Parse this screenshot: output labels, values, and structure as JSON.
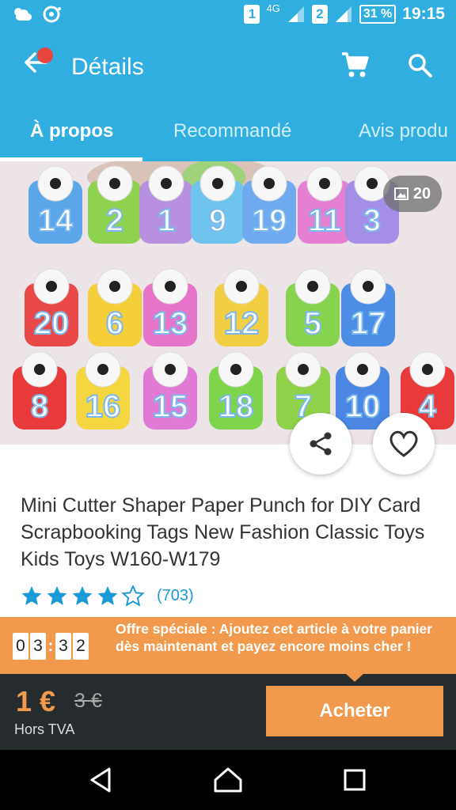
{
  "status_bar": {
    "network_4g": "4G",
    "sim1": "1",
    "sim2": "2",
    "battery": "31 %",
    "time": "19:15"
  },
  "app_bar": {
    "title": "Détails",
    "back_icon": "back-arrow-icon",
    "cart_icon": "cart-icon",
    "search_icon": "search-icon"
  },
  "tabs": [
    {
      "label": "À propos",
      "active": true
    },
    {
      "label": "Recommandé",
      "active": false
    },
    {
      "label": "Avis produ",
      "active": false
    }
  ],
  "hero": {
    "photo_count": "20",
    "punch_numbers": [
      "14",
      "2",
      "1",
      "9",
      "19",
      "11",
      "3",
      "20",
      "6",
      "13",
      "12",
      "5",
      "17",
      "8",
      "16",
      "15",
      "18",
      "7",
      "10",
      "4"
    ]
  },
  "product": {
    "title": "Mini Cutter Shaper Paper Punch for DIY Card Scrapbooking Tags New Fashion Classic Toys Kids Toys W160-W179",
    "rating": 4,
    "rating_max": 5,
    "review_count": "(703)"
  },
  "promo": {
    "countdown": [
      "0",
      "3",
      "3",
      "2"
    ],
    "text": "Offre spéciale : Ajoutez cet article à votre panier dès maintenant et payez encore moins cher !"
  },
  "purchase": {
    "price": "1 €",
    "old_price": "3 €",
    "tax_label": "Hors TVA",
    "buy_label": "Acheter"
  },
  "colors": {
    "primary": "#30aee0",
    "accent": "#f19a4d",
    "dark": "#262b2d",
    "star": "#1a9ad6"
  }
}
